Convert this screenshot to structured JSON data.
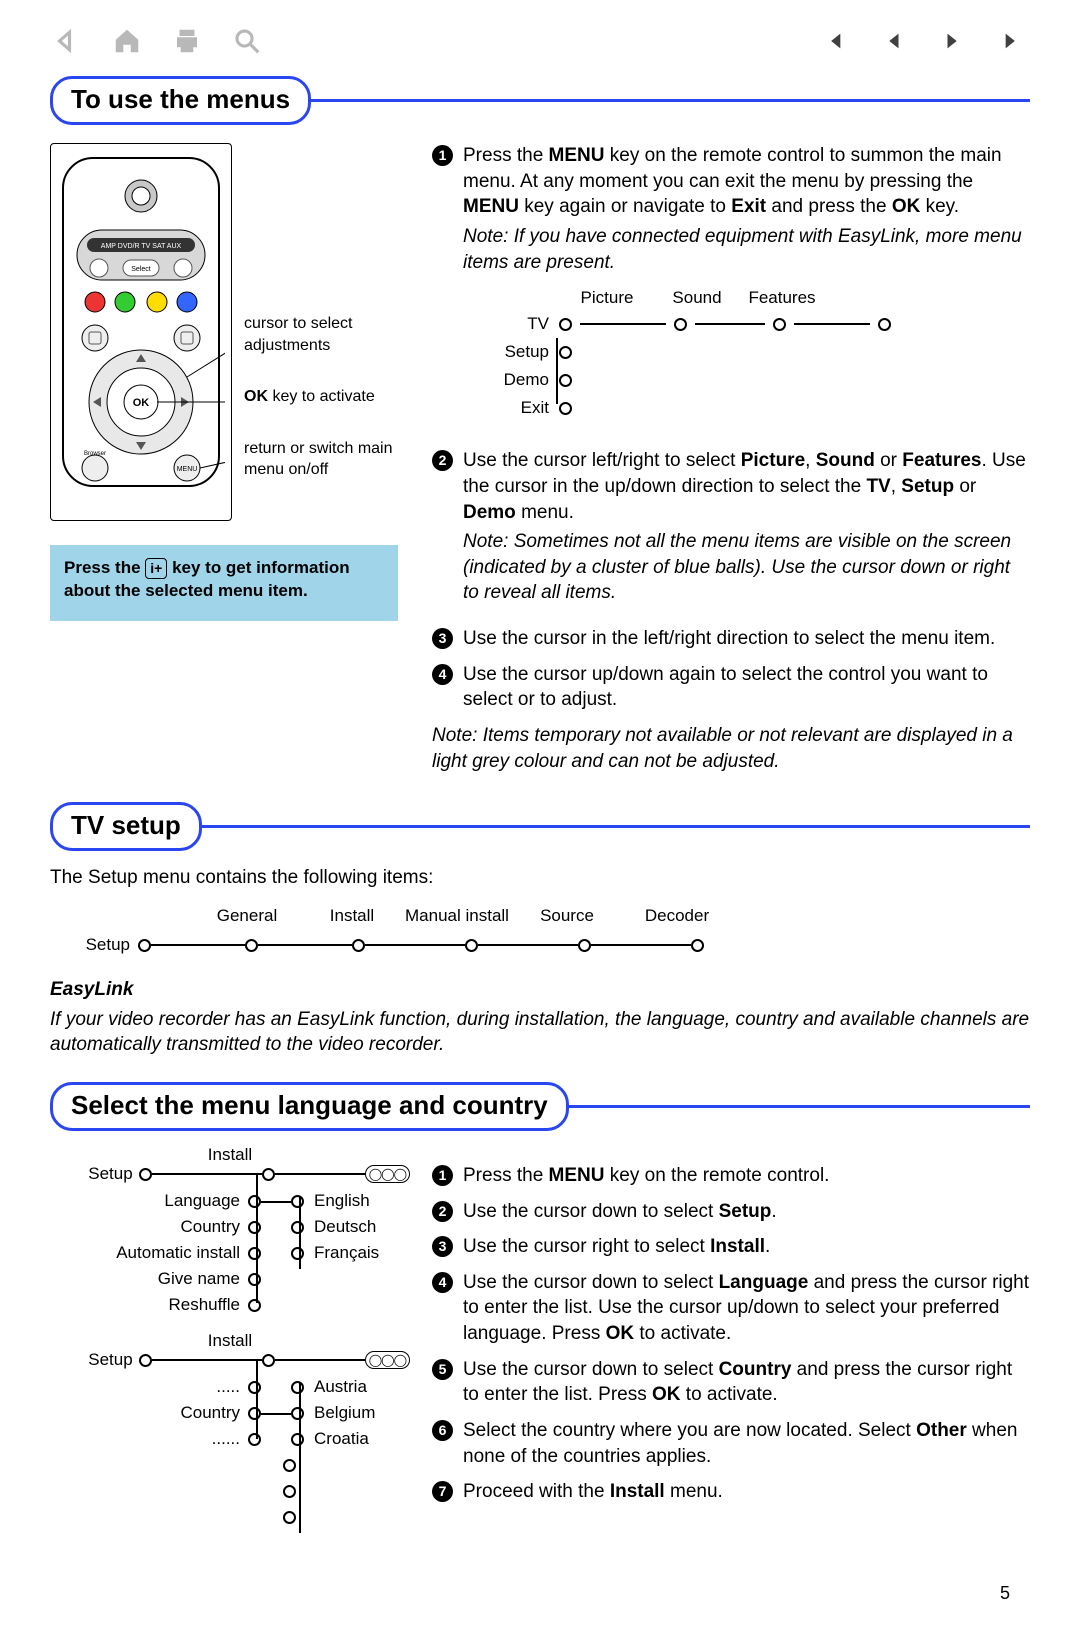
{
  "toolbar": {
    "back": "back-icon",
    "home": "home-icon",
    "print": "print-icon",
    "search": "search-icon",
    "first": "first-page-icon",
    "prev": "prev-page-icon",
    "next": "next-page-icon",
    "last": "last-page-icon"
  },
  "section1": {
    "heading": "To use the menus",
    "remote_labels": {
      "cursor": "cursor to select adjustments",
      "ok_bold": "OK",
      "ok_rest": " key to activate",
      "menu": "return or switch main menu on/off",
      "device_strip": "AMP  DVD/R  TV  SAT  AUX",
      "ok_button": "OK",
      "browser": "Browser",
      "menu_btn": "MENU",
      "select_btn": "Select"
    },
    "hint_pre": "Press the ",
    "hint_icon": "i+",
    "hint_post": " key to get information about the selected menu item.",
    "menu_top": {
      "tv": "TV",
      "setup": "Setup",
      "demo": "Demo",
      "exit": "Exit",
      "picture": "Picture",
      "sound": "Sound",
      "features": "Features"
    },
    "steps": [
      {
        "html": "Press the <b>MENU</b> key on the remote control to summon the main menu. At any moment you can exit the menu by pressing the <b>MENU</b> key again or navigate to <b>Exit</b> and press the <b>OK</b> key.",
        "note": "Note: If you have connected equipment with EasyLink, more menu items are present."
      },
      {
        "html": "Use the cursor left/right to select <b>Picture</b>, <b>Sound</b> or <b>Features</b>. Use the cursor in the up/down direction to select the <b>TV</b>, <b>Setup</b> or <b>Demo</b> menu.",
        "note": "Note: Sometimes not all the menu items are visible on the screen (indicated by a cluster of blue balls). Use the cursor down or right to reveal all items."
      },
      {
        "html": "Use the cursor in the left/right direction to select the menu item."
      },
      {
        "html": "Use the cursor up/down again to select the control you want to select or to adjust."
      }
    ],
    "bottom_note": "Note: Items temporary not available or not relevant are displayed in a light grey colour and can not be adjusted."
  },
  "section2": {
    "heading": "TV setup",
    "intro": "The Setup menu contains the following items:",
    "setup_label": "Setup",
    "items": [
      "General",
      "Install",
      "Manual install",
      "Source",
      "Decoder"
    ],
    "easylink_h": "EasyLink",
    "easylink_p": "If your video recorder has an EasyLink function, during installation, the language, country and available channels are automatically transmitted to the video recorder."
  },
  "section3": {
    "heading": "Select the menu language and country",
    "diag1": {
      "setup": "Setup",
      "install": "Install",
      "rows": [
        "Language",
        "Country",
        "Automatic install",
        "Give name",
        "Reshuffle"
      ],
      "langs": [
        "English",
        "Deutsch",
        "Français"
      ]
    },
    "diag2": {
      "setup": "Setup",
      "install": "Install",
      "dots_top": ".....",
      "country": "Country",
      "dots_bot": "......",
      "countries": [
        "Austria",
        "Belgium",
        "Croatia"
      ]
    },
    "steps": [
      {
        "html": "Press the <b>MENU</b> key on the remote control."
      },
      {
        "html": "Use the cursor down to select <b>Setup</b>."
      },
      {
        "html": "Use the cursor right to select <b>Install</b>."
      },
      {
        "html": "Use the cursor down to select <b>Language</b> and press the cursor right to enter the list. Use the cursor up/down to select your preferred language. Press <b>OK</b> to activate."
      },
      {
        "html": "Use the cursor down to select <b>Country</b> and press the cursor right to enter the list. Press <b>OK</b> to activate."
      },
      {
        "html": "Select the country where you are now located. Select <b>Other</b> when none of the countries applies."
      },
      {
        "html": "Proceed with the <b>Install</b> menu."
      }
    ]
  },
  "page_number": "5"
}
